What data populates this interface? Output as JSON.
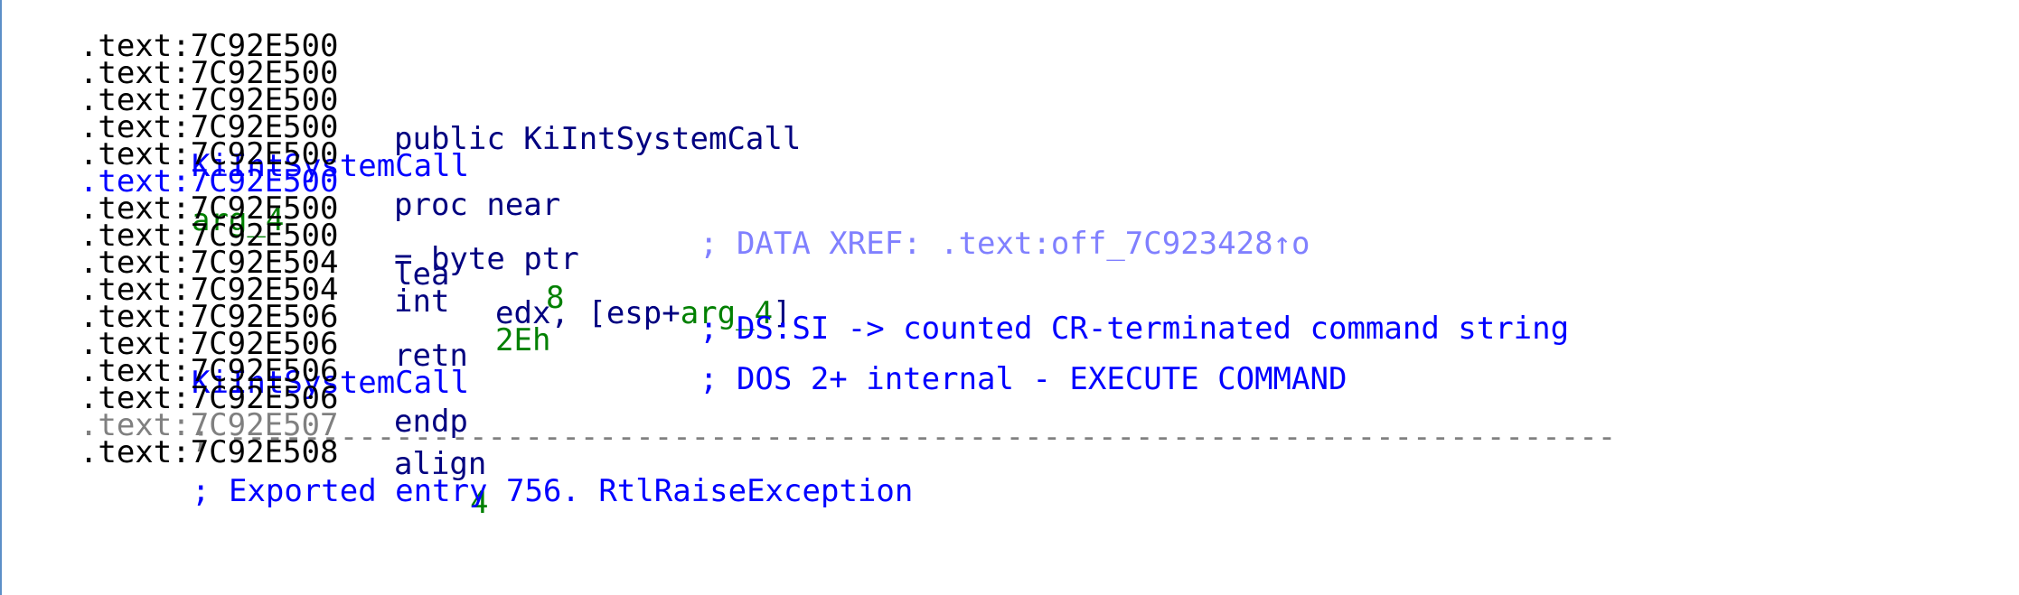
{
  "lines": [
    {
      "addr": ".text:7C92E500"
    },
    {
      "addr": ".text:7C92E500"
    },
    {
      "addr": ".text:7C92E500",
      "code": "public KiIntSystemCall"
    },
    {
      "addr": ".text:7C92E500",
      "label": "KiIntSystemCall",
      "code": "proc near",
      "comment": "; DATA XREF: .text:off_7C923428↑o"
    },
    {
      "addr": ".text:7C92E500"
    },
    {
      "addr": ".text:7C92E500",
      "var": "arg_4",
      "code": "= byte ptr",
      "num": "8"
    },
    {
      "addr": ".text:7C92E500"
    },
    {
      "addr": ".text:7C92E500",
      "mnemonic": "lea",
      "op_a": "edx, [esp+",
      "op_var": "arg_4",
      "op_b": "]"
    },
    {
      "addr": ".text:7C92E504",
      "mnemonic": "int",
      "num": "2Eh",
      "comment": "; DOS 2+ internal - EXECUTE COMMAND"
    },
    {
      "addr": ".text:7C92E504",
      "comment": "; DS:SI -> counted CR-terminated command string"
    },
    {
      "addr": ".text:7C92E506",
      "mnemonic": "retn"
    },
    {
      "addr": ".text:7C92E506",
      "label": "KiIntSystemCall",
      "code": "endp"
    },
    {
      "addr": ".text:7C92E506"
    },
    {
      "addr": ".text:7C92E506",
      "separator": "; ---------------------------------------------------------------------------"
    },
    {
      "addr": ".text:7C92E507",
      "code": "align",
      "num": "4"
    },
    {
      "addr": ".text:7C92E508",
      "comment": "; Exported entry 756. RtlRaiseException"
    }
  ]
}
